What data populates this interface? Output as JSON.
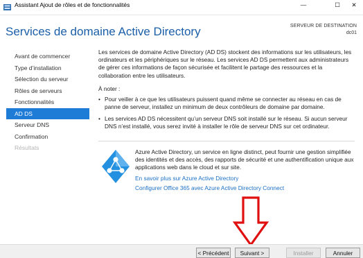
{
  "window": {
    "title": "Assistant Ajout de rôles et de fonctionnalités",
    "minimize_glyph": "—",
    "maximize_glyph": "☐",
    "close_glyph": "✕"
  },
  "header": {
    "page_title": "Services de domaine Active Directory",
    "dest_label": "SERVEUR DE DESTINATION",
    "dest_value": "dc01"
  },
  "nav": {
    "items": [
      {
        "label": "Avant de commencer",
        "state": "normal"
      },
      {
        "label": "Type d’installation",
        "state": "normal"
      },
      {
        "label": "Sélection du serveur",
        "state": "normal"
      },
      {
        "label": "Rôles de serveurs",
        "state": "normal"
      },
      {
        "label": "Fonctionnalités",
        "state": "normal"
      },
      {
        "label": "AD DS",
        "state": "active"
      },
      {
        "label": "Serveur DNS",
        "state": "normal"
      },
      {
        "label": "Confirmation",
        "state": "normal"
      },
      {
        "label": "Résultats",
        "state": "disabled"
      }
    ]
  },
  "content": {
    "intro": "Les services de domaine Active Directory (AD DS) stockent des informations sur les utilisateurs, les ordinateurs et les périphériques sur le réseau. Les services AD DS permettent aux administrateurs de gérer ces informations de façon sécurisée et facilitent le partage des ressources et la collaboration entre les utilisateurs.",
    "note_title": "À noter :",
    "bullet_glyph": "•",
    "bullets": [
      "Pour veiller à ce que les utilisateurs puissent quand même se connecter au réseau en cas de panne de serveur, installez un minimum de deux contrôleurs de domaine par domaine.",
      "Les services AD DS nécessitent qu’un serveur DNS soit installé sur le réseau. Si aucun serveur DNS n’est installé, vous serez invité à installer le rôle de serveur DNS sur cet ordinateur."
    ],
    "azure_desc": "Azure Active Directory, un service en ligne distinct, peut fournir une gestion simplifiée des identités et des accès, des rapports de sécurité et une authentification unique aux applications web dans le cloud et sur site.",
    "link1": "En savoir plus sur Azure Active Directory",
    "link2": "Configurer Office 365 avec Azure Active Directory Connect"
  },
  "footer": {
    "prev": "< Précédent",
    "next": "Suivant >",
    "install": "Installer",
    "cancel": "Annuler"
  },
  "colors": {
    "accent": "#1e7bd6",
    "title_blue": "#1a5ea8",
    "link_blue": "#1a6fc5",
    "annotation_arrow": "#e01010"
  },
  "icons": {
    "app": "server-manager-icon",
    "azure": "azure-ad-logo",
    "annotation": "red-down-arrow"
  }
}
